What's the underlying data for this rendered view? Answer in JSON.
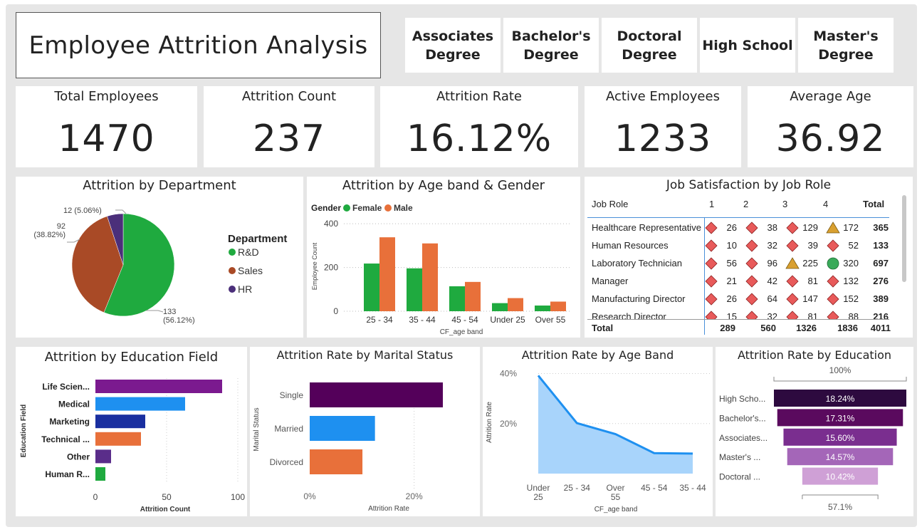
{
  "title": "Employee Attrition Analysis",
  "slicer": [
    "Associates\nDegree",
    "Bachelor's\nDegree",
    "Doctoral\nDegree",
    "High School",
    "Master's\nDegree"
  ],
  "kpis": [
    {
      "title": "Total Employees",
      "value": "1470"
    },
    {
      "title": "Attrition Count",
      "value": "237"
    },
    {
      "title": "Attrition Rate",
      "value": "16.12%"
    },
    {
      "title": "Active Employees",
      "value": "1233"
    },
    {
      "title": "Average Age",
      "value": "36.92"
    }
  ],
  "dept_chart": {
    "title": "Attrition by Department",
    "legend_title": "Department",
    "colors": [
      "#1faa3f",
      "#a94a26",
      "#4b2f7a"
    ],
    "chart_data": {
      "type": "pie",
      "categories": [
        "R&D",
        "Sales",
        "HR"
      ],
      "values": [
        133,
        92,
        12
      ],
      "data_labels": [
        "133\n(56.12%)",
        "92\n(38.82%)",
        "12 (5.06%)"
      ]
    }
  },
  "age_gender_chart": {
    "title": "Attrition by Age band & Gender",
    "legend_title": "Gender",
    "ylabel": "Employee Count",
    "xlabel": "CF_age band",
    "yticks": [
      "400",
      "200",
      "0"
    ],
    "colors": [
      "#1faa3f",
      "#e8703a"
    ],
    "chart_data": {
      "type": "bar",
      "categories": [
        "25 - 34",
        "35 - 44",
        "45 - 54",
        "Under 25",
        "Over 55"
      ],
      "series": [
        {
          "name": "Female",
          "values": [
            218,
            196,
            114,
            37,
            26
          ]
        },
        {
          "name": "Male",
          "values": [
            338,
            310,
            134,
            60,
            44
          ]
        }
      ],
      "ylim": [
        0,
        420
      ]
    }
  },
  "job_satisfaction": {
    "title": "Job Satisfaction by Job Role",
    "header": [
      "Job Role",
      "1",
      "2",
      "3",
      "4",
      "Total"
    ],
    "rows": [
      {
        "role": "Healthcare Representative",
        "v": [
          "26",
          "38",
          "129",
          "172"
        ],
        "icons": [
          "diamond",
          "diamond",
          "diamond",
          "triangle"
        ],
        "total": "365"
      },
      {
        "role": "Human Resources",
        "v": [
          "10",
          "32",
          "39",
          "52"
        ],
        "icons": [
          "diamond",
          "diamond",
          "diamond",
          "diamond"
        ],
        "total": "133"
      },
      {
        "role": "Laboratory Technician",
        "v": [
          "56",
          "96",
          "225",
          "320"
        ],
        "icons": [
          "diamond",
          "diamond",
          "triangle",
          "circle"
        ],
        "total": "697"
      },
      {
        "role": "Manager",
        "v": [
          "21",
          "42",
          "81",
          "132"
        ],
        "icons": [
          "diamond",
          "diamond",
          "diamond",
          "diamond"
        ],
        "total": "276"
      },
      {
        "role": "Manufacturing Director",
        "v": [
          "26",
          "64",
          "147",
          "152"
        ],
        "icons": [
          "diamond",
          "diamond",
          "diamond",
          "diamond"
        ],
        "total": "389"
      },
      {
        "role": "Research Director",
        "v": [
          "15",
          "32",
          "81",
          "88"
        ],
        "icons": [
          "diamond",
          "diamond",
          "diamond",
          "diamond"
        ],
        "total": "216"
      }
    ],
    "totals": {
      "label": "Total",
      "v": [
        "289",
        "560",
        "1326",
        "1836"
      ],
      "total": "4011"
    }
  },
  "edu_field_chart": {
    "title": "Attrition by Education Field",
    "ylabel": "Education Field",
    "xlabel": "Attrition Count",
    "xticks": [
      "0",
      "50",
      "100"
    ],
    "colors": [
      "#7b1a8f",
      "#1e90f0",
      "#1a2fa0",
      "#e8703a",
      "#5a2d8a",
      "#1faa3f"
    ],
    "chart_data": {
      "type": "bar",
      "categories": [
        "Life Scien...",
        "Medical",
        "Marketing",
        "Technical ...",
        "Other",
        "Human R..."
      ],
      "values": [
        89,
        63,
        35,
        32,
        11,
        7
      ],
      "xlim": [
        0,
        100
      ]
    }
  },
  "marital_chart": {
    "title": "Attrition Rate by Marital Status",
    "ylabel": "Marital Status",
    "xlabel": "Attrition Rate",
    "xticks": [
      "0%",
      "20%"
    ],
    "colors": [
      "#54005a",
      "#1e90f0",
      "#e8703a"
    ],
    "chart_data": {
      "type": "bar",
      "categories": [
        "Single",
        "Married",
        "Divorced"
      ],
      "values": [
        25.5,
        12.5,
        10.1
      ],
      "xlim": [
        0,
        30
      ]
    }
  },
  "ageband_chart": {
    "title": "Attrition Rate by Age Band",
    "ylabel": "Attrition Rate",
    "xlabel": "CF_age band",
    "yticks": [
      "40%",
      "20%"
    ],
    "colors": [
      "#1e90f0",
      "#a8d4fb"
    ],
    "chart_data": {
      "type": "area",
      "categories": [
        "Under\n25",
        "25 - 34",
        "Over\n55",
        "45 - 54",
        "35 - 44"
      ],
      "values": [
        39.2,
        20.2,
        15.8,
        8.2,
        8.0
      ],
      "ylim": [
        0,
        45
      ]
    }
  },
  "education_chart": {
    "title": "Attrition Rate by Education",
    "top_label": "100%",
    "bottom_label": "57.1%",
    "colors": [
      "#2d0a3f",
      "#5a0a5e",
      "#7a2e8f",
      "#a466b8",
      "#cfa0d6"
    ],
    "chart_data": {
      "type": "bar",
      "categories": [
        "High Scho...",
        "Bachelor's...",
        "Associates...",
        "Master's ...",
        "Doctoral ..."
      ],
      "values": [
        18.24,
        17.31,
        15.6,
        14.57,
        10.42
      ],
      "data_labels": [
        "18.24%",
        "17.31%",
        "15.60%",
        "14.57%",
        "10.42%"
      ]
    }
  }
}
